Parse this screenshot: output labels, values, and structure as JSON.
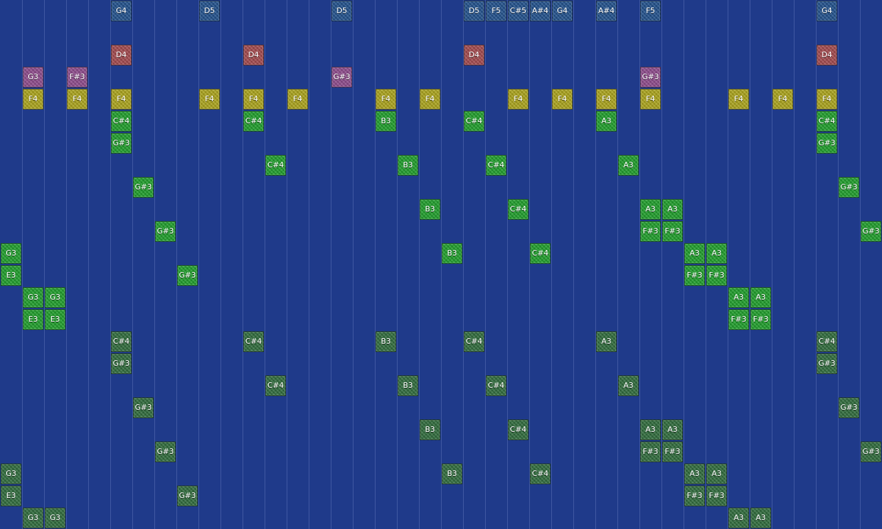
{
  "colors": {
    "background": "#1f3a8a",
    "blue": "#21508a",
    "red": "#a0484d",
    "purple": "#8c4a8a",
    "yellow": "#a9a21c",
    "green": "#1f9c2b",
    "dgreen": "#2f6a3c"
  },
  "notes": [
    {
      "label": "G4",
      "col": 5,
      "row": 0,
      "color": "blue"
    },
    {
      "label": "D5",
      "col": 9,
      "row": 0,
      "color": "blue"
    },
    {
      "label": "D5",
      "col": 15,
      "row": 0,
      "color": "blue"
    },
    {
      "label": "D5",
      "col": 21,
      "row": 0,
      "color": "blue"
    },
    {
      "label": "F5",
      "col": 22,
      "row": 0,
      "color": "blue"
    },
    {
      "label": "C#5",
      "col": 23,
      "row": 0,
      "color": "blue"
    },
    {
      "label": "A#4",
      "col": 24,
      "row": 0,
      "color": "blue"
    },
    {
      "label": "G4",
      "col": 25,
      "row": 0,
      "color": "blue"
    },
    {
      "label": "A#4",
      "col": 27,
      "row": 0,
      "color": "blue"
    },
    {
      "label": "F5",
      "col": 29,
      "row": 0,
      "color": "blue"
    },
    {
      "label": "G4",
      "col": 37,
      "row": 0,
      "color": "blue"
    },
    {
      "label": "D4",
      "col": 5,
      "row": 2,
      "color": "red"
    },
    {
      "label": "D4",
      "col": 11,
      "row": 2,
      "color": "red"
    },
    {
      "label": "D4",
      "col": 21,
      "row": 2,
      "color": "red"
    },
    {
      "label": "D4",
      "col": 37,
      "row": 2,
      "color": "red"
    },
    {
      "label": "G3",
      "col": 1,
      "row": 3,
      "color": "purple"
    },
    {
      "label": "F#3",
      "col": 3,
      "row": 3,
      "color": "purple"
    },
    {
      "label": "G#3",
      "col": 15,
      "row": 3,
      "color": "purple"
    },
    {
      "label": "G#3",
      "col": 29,
      "row": 3,
      "color": "purple"
    },
    {
      "label": "F4",
      "col": 1,
      "row": 4,
      "color": "yellow"
    },
    {
      "label": "F4",
      "col": 3,
      "row": 4,
      "color": "yellow"
    },
    {
      "label": "F4",
      "col": 5,
      "row": 4,
      "color": "yellow"
    },
    {
      "label": "F4",
      "col": 9,
      "row": 4,
      "color": "yellow"
    },
    {
      "label": "F4",
      "col": 11,
      "row": 4,
      "color": "yellow"
    },
    {
      "label": "F4",
      "col": 13,
      "row": 4,
      "color": "yellow"
    },
    {
      "label": "F4",
      "col": 17,
      "row": 4,
      "color": "yellow"
    },
    {
      "label": "F4",
      "col": 19,
      "row": 4,
      "color": "yellow"
    },
    {
      "label": "F4",
      "col": 23,
      "row": 4,
      "color": "yellow"
    },
    {
      "label": "F4",
      "col": 25,
      "row": 4,
      "color": "yellow"
    },
    {
      "label": "F4",
      "col": 27,
      "row": 4,
      "color": "yellow"
    },
    {
      "label": "F4",
      "col": 29,
      "row": 4,
      "color": "yellow"
    },
    {
      "label": "F4",
      "col": 33,
      "row": 4,
      "color": "yellow"
    },
    {
      "label": "F4",
      "col": 35,
      "row": 4,
      "color": "yellow"
    },
    {
      "label": "F4",
      "col": 37,
      "row": 4,
      "color": "yellow"
    },
    {
      "label": "C#4",
      "col": 5,
      "row": 5,
      "color": "green"
    },
    {
      "label": "C#4",
      "col": 11,
      "row": 5,
      "color": "green"
    },
    {
      "label": "B3",
      "col": 17,
      "row": 5,
      "color": "green"
    },
    {
      "label": "C#4",
      "col": 21,
      "row": 5,
      "color": "green"
    },
    {
      "label": "A3",
      "col": 27,
      "row": 5,
      "color": "green"
    },
    {
      "label": "C#4",
      "col": 37,
      "row": 5,
      "color": "green"
    },
    {
      "label": "G#3",
      "col": 5,
      "row": 6,
      "color": "green"
    },
    {
      "label": "G#3",
      "col": 37,
      "row": 6,
      "color": "green"
    },
    {
      "label": "C#4",
      "col": 12,
      "row": 7,
      "color": "green"
    },
    {
      "label": "B3",
      "col": 18,
      "row": 7,
      "color": "green"
    },
    {
      "label": "C#4",
      "col": 22,
      "row": 7,
      "color": "green"
    },
    {
      "label": "A3",
      "col": 28,
      "row": 7,
      "color": "green"
    },
    {
      "label": "G#3",
      "col": 6,
      "row": 8,
      "color": "green"
    },
    {
      "label": "G#3",
      "col": 38,
      "row": 8,
      "color": "green"
    },
    {
      "label": "B3",
      "col": 19,
      "row": 9,
      "color": "green"
    },
    {
      "label": "C#4",
      "col": 23,
      "row": 9,
      "color": "green"
    },
    {
      "label": "A3",
      "col": 29,
      "row": 9,
      "color": "green"
    },
    {
      "label": "A3",
      "col": 30,
      "row": 9,
      "color": "green"
    },
    {
      "label": "G#3",
      "col": 7,
      "row": 10,
      "color": "green"
    },
    {
      "label": "F#3",
      "col": 29,
      "row": 10,
      "color": "green"
    },
    {
      "label": "F#3",
      "col": 30,
      "row": 10,
      "color": "green"
    },
    {
      "label": "G#3",
      "col": 39,
      "row": 10,
      "color": "green"
    },
    {
      "label": "G3",
      "col": 0,
      "row": 11,
      "color": "green"
    },
    {
      "label": "B3",
      "col": 20,
      "row": 11,
      "color": "green"
    },
    {
      "label": "C#4",
      "col": 24,
      "row": 11,
      "color": "green"
    },
    {
      "label": "A3",
      "col": 31,
      "row": 11,
      "color": "green"
    },
    {
      "label": "A3",
      "col": 32,
      "row": 11,
      "color": "green"
    },
    {
      "label": "E3",
      "col": 0,
      "row": 12,
      "color": "green"
    },
    {
      "label": "G#3",
      "col": 8,
      "row": 12,
      "color": "green"
    },
    {
      "label": "F#3",
      "col": 31,
      "row": 12,
      "color": "green"
    },
    {
      "label": "F#3",
      "col": 32,
      "row": 12,
      "color": "green"
    },
    {
      "label": "G3",
      "col": 1,
      "row": 13,
      "color": "green"
    },
    {
      "label": "G3",
      "col": 2,
      "row": 13,
      "color": "green"
    },
    {
      "label": "A3",
      "col": 33,
      "row": 13,
      "color": "green"
    },
    {
      "label": "A3",
      "col": 34,
      "row": 13,
      "color": "green"
    },
    {
      "label": "E3",
      "col": 1,
      "row": 14,
      "color": "green"
    },
    {
      "label": "E3",
      "col": 2,
      "row": 14,
      "color": "green"
    },
    {
      "label": "F#3",
      "col": 33,
      "row": 14,
      "color": "green"
    },
    {
      "label": "F#3",
      "col": 34,
      "row": 14,
      "color": "green"
    },
    {
      "label": "C#4",
      "col": 5,
      "row": 15,
      "color": "dgreen"
    },
    {
      "label": "C#4",
      "col": 11,
      "row": 15,
      "color": "dgreen"
    },
    {
      "label": "B3",
      "col": 17,
      "row": 15,
      "color": "dgreen"
    },
    {
      "label": "C#4",
      "col": 21,
      "row": 15,
      "color": "dgreen"
    },
    {
      "label": "A3",
      "col": 27,
      "row": 15,
      "color": "dgreen"
    },
    {
      "label": "C#4",
      "col": 37,
      "row": 15,
      "color": "dgreen"
    },
    {
      "label": "G#3",
      "col": 5,
      "row": 16,
      "color": "dgreen"
    },
    {
      "label": "G#3",
      "col": 37,
      "row": 16,
      "color": "dgreen"
    },
    {
      "label": "C#4",
      "col": 12,
      "row": 17,
      "color": "dgreen"
    },
    {
      "label": "B3",
      "col": 18,
      "row": 17,
      "color": "dgreen"
    },
    {
      "label": "C#4",
      "col": 22,
      "row": 17,
      "color": "dgreen"
    },
    {
      "label": "A3",
      "col": 28,
      "row": 17,
      "color": "dgreen"
    },
    {
      "label": "G#3",
      "col": 6,
      "row": 18,
      "color": "dgreen"
    },
    {
      "label": "G#3",
      "col": 38,
      "row": 18,
      "color": "dgreen"
    },
    {
      "label": "B3",
      "col": 19,
      "row": 19,
      "color": "dgreen"
    },
    {
      "label": "C#4",
      "col": 23,
      "row": 19,
      "color": "dgreen"
    },
    {
      "label": "A3",
      "col": 29,
      "row": 19,
      "color": "dgreen"
    },
    {
      "label": "A3",
      "col": 30,
      "row": 19,
      "color": "dgreen"
    },
    {
      "label": "G#3",
      "col": 7,
      "row": 20,
      "color": "dgreen"
    },
    {
      "label": "F#3",
      "col": 29,
      "row": 20,
      "color": "dgreen"
    },
    {
      "label": "F#3",
      "col": 30,
      "row": 20,
      "color": "dgreen"
    },
    {
      "label": "G#3",
      "col": 39,
      "row": 20,
      "color": "dgreen"
    },
    {
      "label": "G3",
      "col": 0,
      "row": 21,
      "color": "dgreen"
    },
    {
      "label": "B3",
      "col": 20,
      "row": 21,
      "color": "dgreen"
    },
    {
      "label": "C#4",
      "col": 24,
      "row": 21,
      "color": "dgreen"
    },
    {
      "label": "A3",
      "col": 31,
      "row": 21,
      "color": "dgreen"
    },
    {
      "label": "A3",
      "col": 32,
      "row": 21,
      "color": "dgreen"
    },
    {
      "label": "E3",
      "col": 0,
      "row": 22,
      "color": "dgreen"
    },
    {
      "label": "G#3",
      "col": 8,
      "row": 22,
      "color": "dgreen"
    },
    {
      "label": "F#3",
      "col": 31,
      "row": 22,
      "color": "dgreen"
    },
    {
      "label": "F#3",
      "col": 32,
      "row": 22,
      "color": "dgreen"
    },
    {
      "label": "G3",
      "col": 1,
      "row": 23,
      "color": "dgreen"
    },
    {
      "label": "G3",
      "col": 2,
      "row": 23,
      "color": "dgreen"
    },
    {
      "label": "A3",
      "col": 33,
      "row": 23,
      "color": "dgreen"
    },
    {
      "label": "A3",
      "col": 34,
      "row": 23,
      "color": "dgreen"
    }
  ]
}
